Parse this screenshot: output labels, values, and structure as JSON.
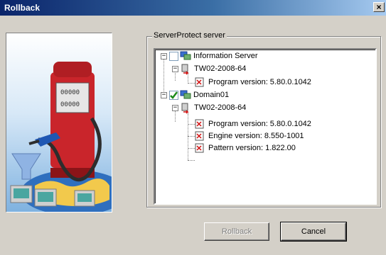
{
  "window": {
    "title": "Rollback",
    "close_symbol": "×"
  },
  "group": {
    "label": "ServerProtect server"
  },
  "tree": {
    "nodes": [
      {
        "label": "Information Server",
        "checked": false
      },
      {
        "label": "TW02-2008-64"
      },
      {
        "label": "Program version: 5.80.0.1042"
      },
      {
        "label": "Domain01",
        "checked": true
      },
      {
        "label": "TW02-2008-64"
      },
      {
        "label": "Program version: 5.80.0.1042"
      },
      {
        "label": "Engine version: 8.550-1001"
      },
      {
        "label": "Pattern version: 1.822.00"
      }
    ],
    "expander_symbol": "−"
  },
  "art": {
    "pump_digits_1": "00000",
    "pump_digits_2": "00000"
  },
  "buttons": {
    "rollback": "Rollback",
    "cancel": "Cancel"
  }
}
